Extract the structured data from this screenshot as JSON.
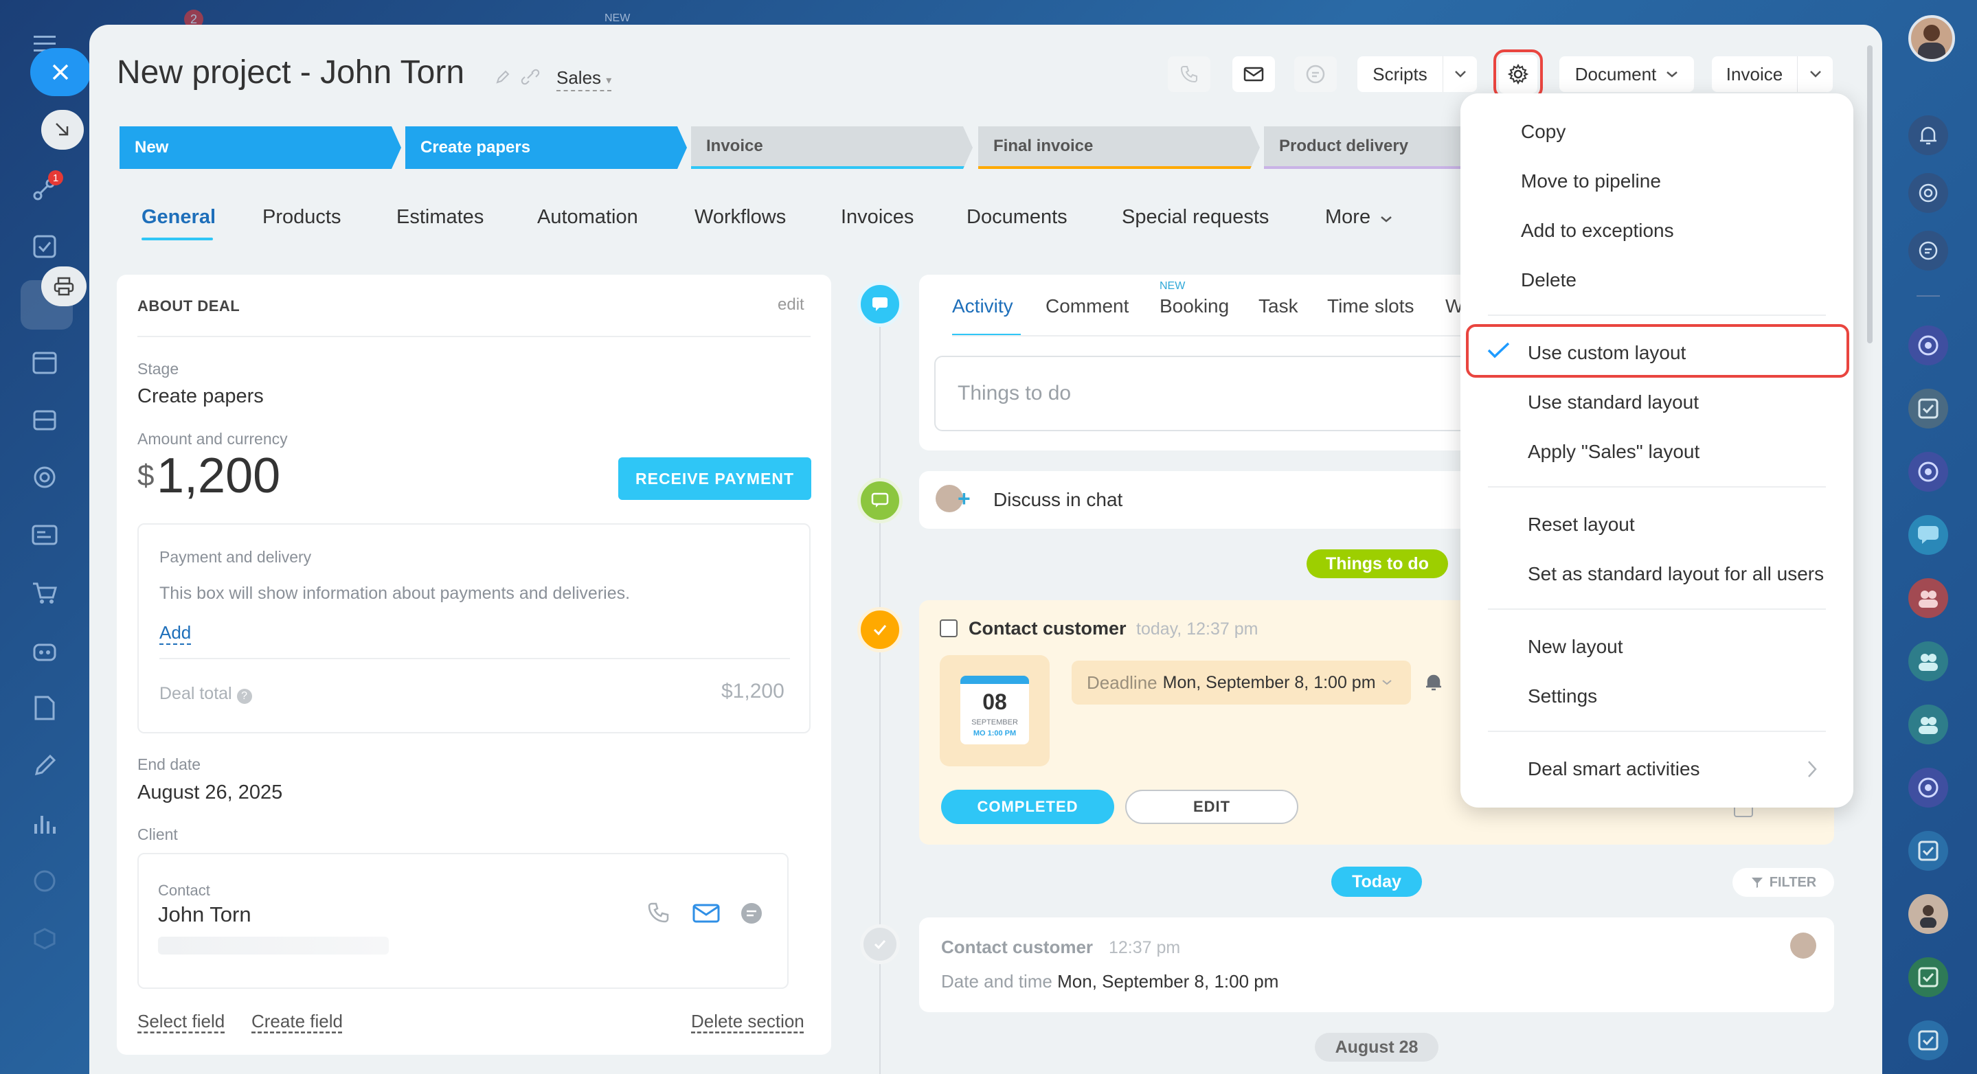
{
  "header": {
    "title": "New project - John Torn",
    "pipeline": "Sales",
    "scripts_label": "Scripts",
    "document_label": "Document",
    "invoice_label": "Invoice"
  },
  "stages": [
    "New",
    "Create papers",
    "Invoice",
    "Final invoice",
    "Product delivery"
  ],
  "tabs": [
    "General",
    "Products",
    "Estimates",
    "Automation",
    "Workflows",
    "Invoices",
    "Documents",
    "Special requests",
    "More"
  ],
  "about": {
    "section_title": "ABOUT DEAL",
    "edit_label": "edit",
    "stage_label": "Stage",
    "stage_value": "Create papers",
    "amount_label": "Amount and currency",
    "currency": "$",
    "amount": "1,200",
    "receive_payment": "RECEIVE PAYMENT",
    "payment_title": "Payment and delivery",
    "payment_desc": "This box will show information about payments and deliveries.",
    "add_label": "Add",
    "deal_total_label": "Deal total",
    "deal_total_value": "$1,200",
    "end_date_label": "End date",
    "end_date_value": "August 26, 2025",
    "client_label": "Client",
    "contact_label": "Contact",
    "contact_name": "John Torn",
    "select_field": "Select field",
    "create_field": "Create field",
    "delete_section": "Delete section"
  },
  "activity": {
    "tabs": [
      "Activity",
      "Comment",
      "Booking",
      "Task",
      "Time slots",
      "W"
    ],
    "booking_badge": "NEW",
    "placeholder": "Things to do",
    "discuss": "Discuss in chat",
    "things_to_do_badge": "Things to do",
    "task_title": "Contact customer",
    "task_time": "today, 12:37 pm",
    "deadline_label": "Deadline",
    "deadline_value": "Mon, September 8, 1:00 pm",
    "cal_day": "08",
    "cal_month": "SEPTEMBER",
    "cal_time": "MO 1:00 PM",
    "completed_btn": "COMPLETED",
    "edit_btn": "EDIT",
    "today_badge": "Today",
    "filter_label": "FILTER",
    "history_title": "Contact customer",
    "history_time": "12:37 pm",
    "history_date_label": "Date and time",
    "history_date_value": "Mon, September 8, 1:00 pm",
    "date_badge": "August 28"
  },
  "menu": {
    "items": [
      "Copy",
      "Move to pipeline",
      "Add to exceptions",
      "Delete",
      "Use custom layout",
      "Use standard layout",
      "Apply \"Sales\" layout",
      "Reset layout",
      "Set as standard layout for all users",
      "New layout",
      "Settings",
      "Deal smart activities"
    ]
  },
  "topbar": {
    "new_label": "NEW",
    "badge_count": "2",
    "nav_badge": "1"
  },
  "colors": {
    "accent": "#2fc6f6",
    "blue": "#1e9bff",
    "highlight": "#e9453f",
    "green": "#9dcf00",
    "orange": "#ffa900"
  }
}
